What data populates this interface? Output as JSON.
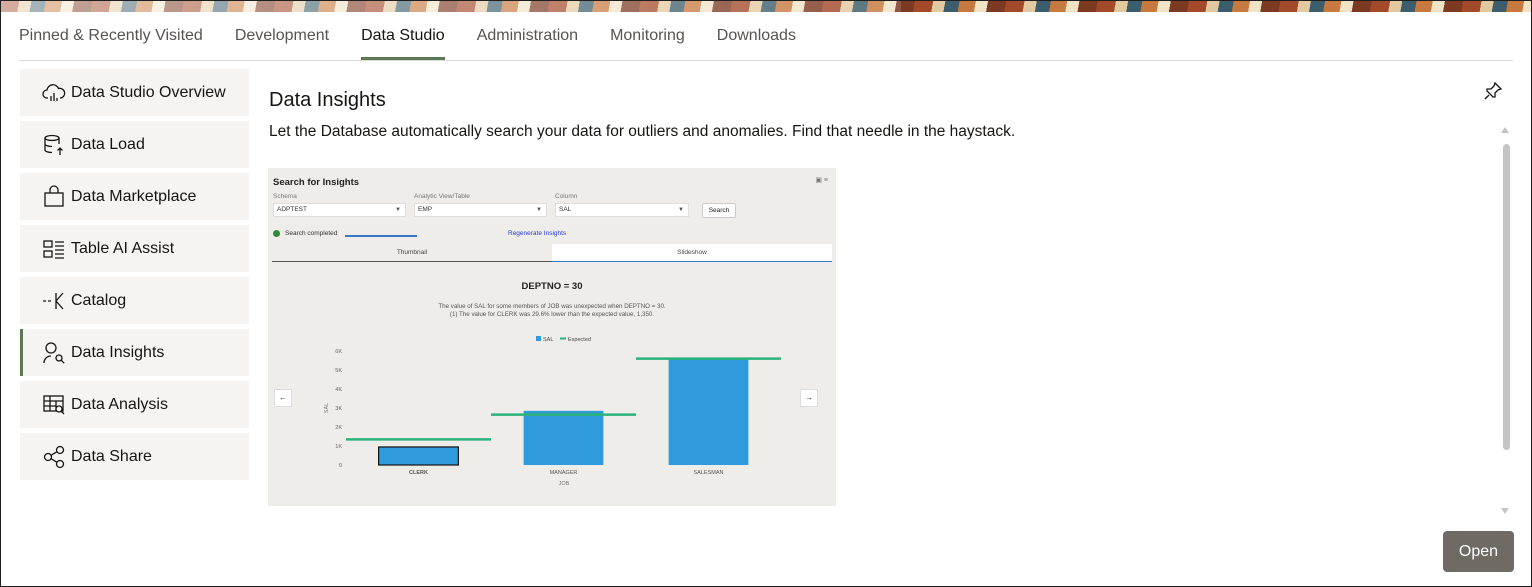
{
  "tabs": [
    {
      "label": "Pinned & Recently Visited",
      "active": false
    },
    {
      "label": "Development",
      "active": false
    },
    {
      "label": "Data Studio",
      "active": true
    },
    {
      "label": "Administration",
      "active": false
    },
    {
      "label": "Monitoring",
      "active": false
    },
    {
      "label": "Downloads",
      "active": false
    }
  ],
  "sidebar": {
    "items": [
      {
        "label": "Data Studio Overview",
        "icon": "cloud-chart-icon"
      },
      {
        "label": "Data Load",
        "icon": "database-upload-icon"
      },
      {
        "label": "Data Marketplace",
        "icon": "shopping-bag-icon"
      },
      {
        "label": "Table AI Assist",
        "icon": "table-list-icon"
      },
      {
        "label": "Catalog",
        "icon": "catalog-icon"
      },
      {
        "label": "Data Insights",
        "icon": "person-search-icon",
        "active": true
      },
      {
        "label": "Data Analysis",
        "icon": "table-search-icon"
      },
      {
        "label": "Data Share",
        "icon": "share-nodes-icon"
      }
    ]
  },
  "main": {
    "title": "Data Insights",
    "description": "Let the Database automatically search your data for outliers and anomalies. Find that needle in the haystack.",
    "open_label": "Open"
  },
  "preview": {
    "title": "Search for Insights",
    "schema_label": "Schema",
    "schema_value": "ADPTEST",
    "view_label": "Analytic View/Table",
    "view_value": "EMP",
    "column_label": "Column",
    "column_value": "SAL",
    "search_label": "Search",
    "status_text": "Search completed",
    "regenerate_label": "Regenerate Insights",
    "tab_thumbnail": "Thumbnail",
    "tab_slideshow": "Slideshow",
    "insight_heading": "DEPTNO = 30",
    "insight_line1": "The value of SAL for some members of JOB was unexpected when DEPTNO = 30.",
    "insight_line2": "(1) The value for CLERK was 29.6% lower than the expected value, 1,350.",
    "prev_arrow": "←",
    "next_arrow": "→"
  },
  "chart_data": {
    "type": "bar",
    "categories": [
      "CLERK",
      "MANAGER",
      "SALESMAN"
    ],
    "series": [
      {
        "name": "SAL",
        "values": [
          950,
          2850,
          5600
        ]
      },
      {
        "name": "Expected",
        "values": [
          1350,
          2650,
          5600
        ]
      }
    ],
    "xlabel": "JOB",
    "ylabel": "SAL",
    "yticks": [
      "0",
      "1K",
      "2K",
      "3K",
      "4K",
      "5K",
      "6K"
    ],
    "ylim": [
      0,
      6000
    ],
    "colors": {
      "SAL": "#2f9bdc",
      "Expected": "#2bb37a"
    },
    "legend": "top"
  }
}
